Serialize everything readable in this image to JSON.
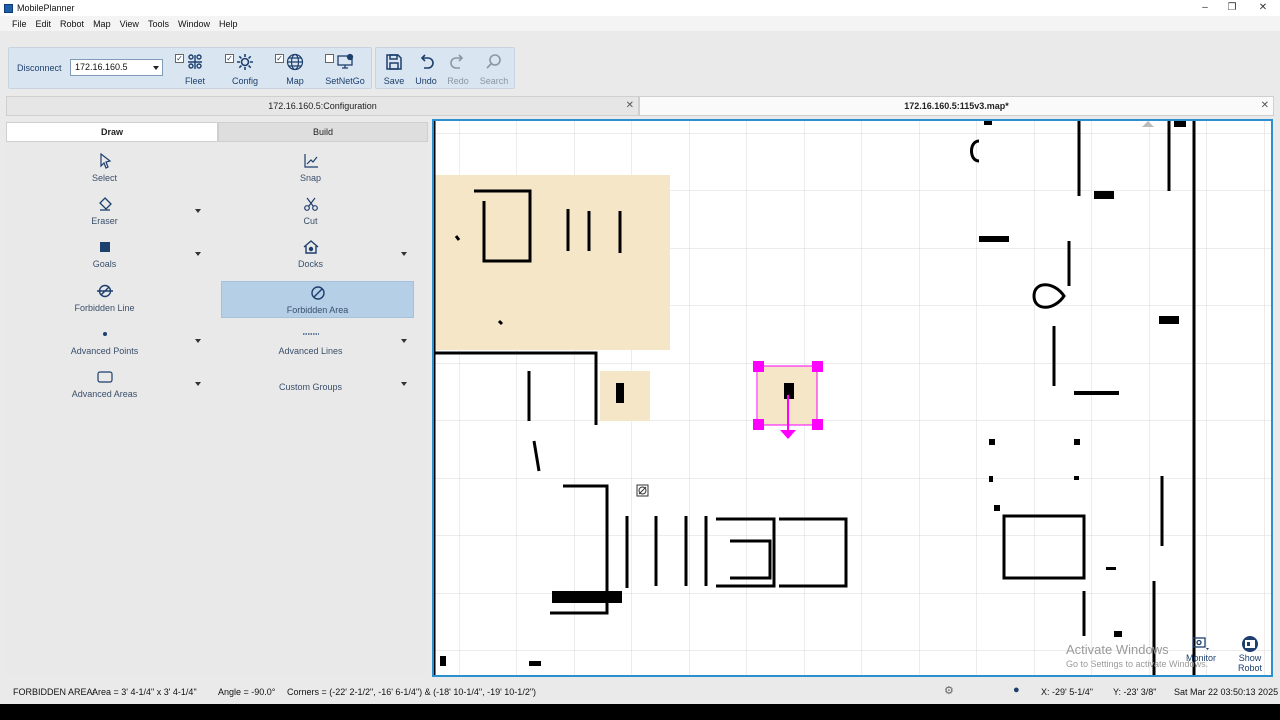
{
  "window": {
    "title": "MobilePlanner",
    "controls": [
      "–",
      "❐",
      "✕"
    ]
  },
  "menu": [
    "File",
    "Edit",
    "Robot",
    "Map",
    "View",
    "Tools",
    "Window",
    "Help"
  ],
  "connection": {
    "disconnect_label": "Disconnect",
    "ip": "172.16.160.5"
  },
  "toggles": [
    {
      "label": "Fleet",
      "checked": true,
      "icon": "fleet-icon"
    },
    {
      "label": "Config",
      "checked": true,
      "icon": "config-gear-icon"
    },
    {
      "label": "Map",
      "checked": true,
      "icon": "globe-icon"
    },
    {
      "label": "SetNetGo",
      "checked": false,
      "icon": "monitor-network-icon"
    }
  ],
  "edit_buttons": [
    {
      "label": "Save",
      "icon": "save-icon",
      "enabled": true
    },
    {
      "label": "Undo",
      "icon": "undo-icon",
      "enabled": true
    },
    {
      "label": "Redo",
      "icon": "redo-icon",
      "enabled": false
    },
    {
      "label": "Search",
      "icon": "search-icon",
      "enabled": false
    }
  ],
  "tabs": [
    {
      "label": "172.16.160.5:Configuration",
      "active": false
    },
    {
      "label": "172.16.160.5:115v3.map*",
      "active": true
    }
  ],
  "subtabs": {
    "draw": "Draw",
    "build": "Build"
  },
  "tools": [
    {
      "label": "Select",
      "icon": "pointer-icon"
    },
    {
      "label": "Snap",
      "icon": "snap-icon"
    },
    {
      "label": "Eraser",
      "icon": "eraser-icon",
      "dropdown": true
    },
    {
      "label": "Cut",
      "icon": "scissors-icon"
    },
    {
      "label": "Goals",
      "icon": "goal-square-icon",
      "dropdown": true
    },
    {
      "label": "Docks",
      "icon": "dock-house-icon",
      "dropdown": true
    },
    {
      "label": "Forbidden Line",
      "icon": "forbidden-line-icon"
    },
    {
      "label": "Forbidden Area",
      "icon": "forbidden-area-icon",
      "selected": true
    },
    {
      "label": "Advanced Points",
      "icon": "dot-icon",
      "dropdown": true
    },
    {
      "label": "Advanced Lines",
      "icon": "dashed-line-icon",
      "dropdown": true
    },
    {
      "label": "Advanced Areas",
      "icon": "rounded-rect-icon",
      "dropdown": true
    },
    {
      "label": "Custom Groups",
      "icon": "",
      "dropdown": true
    }
  ],
  "status": {
    "type": "FORBIDDEN AREA:",
    "area": "Area =  3' 4-1/4\"  x  3' 4-1/4\"",
    "angle": "Angle =  -90.0°",
    "corners": "Corners =  (-22' 2-1/2\",  -16' 6-1/4\")   &   (-18' 10-1/4\",  -19' 10-1/2\")",
    "x": "X:  -29' 5-1/4\"",
    "y": "Y:  -23' 3/8\"",
    "datetime": "Sat Mar 22 03:50:13 2025"
  },
  "watermark": {
    "line1": "Activate Windows",
    "line2": "Go to Settings to activate Windows."
  },
  "robot_buttons": {
    "monitor": "Monitor",
    "show_robot": "Show Robot"
  },
  "colors": {
    "forbidden_fill": "#f5e6c8",
    "selection_handle": "#ff00ff",
    "map_border": "#2b8fd0",
    "selected_tool": "#b5cfe6"
  }
}
